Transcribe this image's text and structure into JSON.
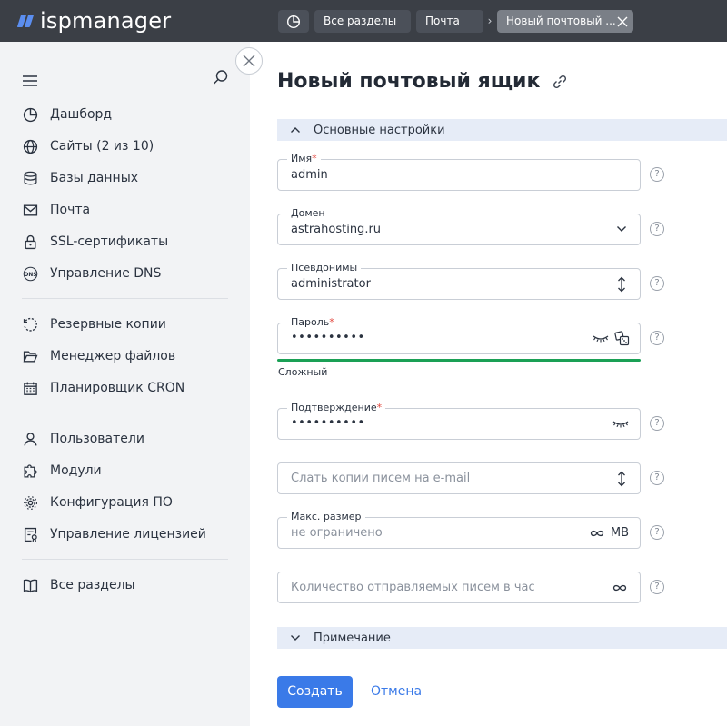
{
  "app": {
    "logo_text": "ispmanager",
    "accent_color": "#3a7ae8"
  },
  "breadcrumbs": {
    "home_icon": "dashboard-icon",
    "items": [
      {
        "label": "Все разделы"
      },
      {
        "label": "Почта"
      }
    ],
    "separator": "›",
    "active": "Новый почтовый ..."
  },
  "sidebar": {
    "groups": [
      [
        {
          "label": "Дашборд",
          "icon": "dashboard-icon"
        },
        {
          "label": "Сайты (2 из 10)",
          "icon": "globe-icon"
        },
        {
          "label": "Базы данных",
          "icon": "database-icon"
        },
        {
          "label": "Почта",
          "icon": "mail-icon"
        },
        {
          "label": "SSL-сертификаты",
          "icon": "lock-icon"
        },
        {
          "label": "Управление DNS",
          "icon": "dns-icon"
        }
      ],
      [
        {
          "label": "Резервные копии",
          "icon": "backup-icon"
        },
        {
          "label": "Менеджер файлов",
          "icon": "folder-icon"
        },
        {
          "label": "Планировщик CRON",
          "icon": "calendar-icon"
        }
      ],
      [
        {
          "label": "Пользователи",
          "icon": "user-icon"
        },
        {
          "label": "Модули",
          "icon": "puzzle-icon"
        },
        {
          "label": "Конфигурация ПО",
          "icon": "gear-icon"
        },
        {
          "label": "Управление лицензией",
          "icon": "license-icon"
        }
      ],
      [
        {
          "label": "Все разделы",
          "icon": "book-icon"
        }
      ]
    ]
  },
  "page": {
    "title": "Новый почтовый ящик"
  },
  "sections": {
    "main": {
      "label": "Основные настройки",
      "expanded": true
    },
    "note": {
      "label": "Примечание",
      "expanded": false
    }
  },
  "form": {
    "name": {
      "label": "Имя",
      "required_mark": "*",
      "value": "admin"
    },
    "domain": {
      "label": "Домен",
      "value": "astrahosting.ru"
    },
    "aliases": {
      "label": "Псевдонимы",
      "value": "administrator"
    },
    "password": {
      "label": "Пароль",
      "required_mark": "*",
      "value": "••••••••••",
      "strength": "Сложный",
      "strength_color": "#1aa055"
    },
    "confirm": {
      "label": "Подтверждение",
      "required_mark": "*",
      "value": "••••••••••"
    },
    "copy_email": {
      "placeholder": "Слать копии писем на e-mail"
    },
    "max_size": {
      "label": "Макс. размер",
      "placeholder": "не ограничено",
      "unit": "MB"
    },
    "send_limit": {
      "placeholder": "Количество отправляемых писем в час"
    },
    "help_glyph": "?"
  },
  "actions": {
    "create": "Создать",
    "cancel": "Отмена"
  }
}
